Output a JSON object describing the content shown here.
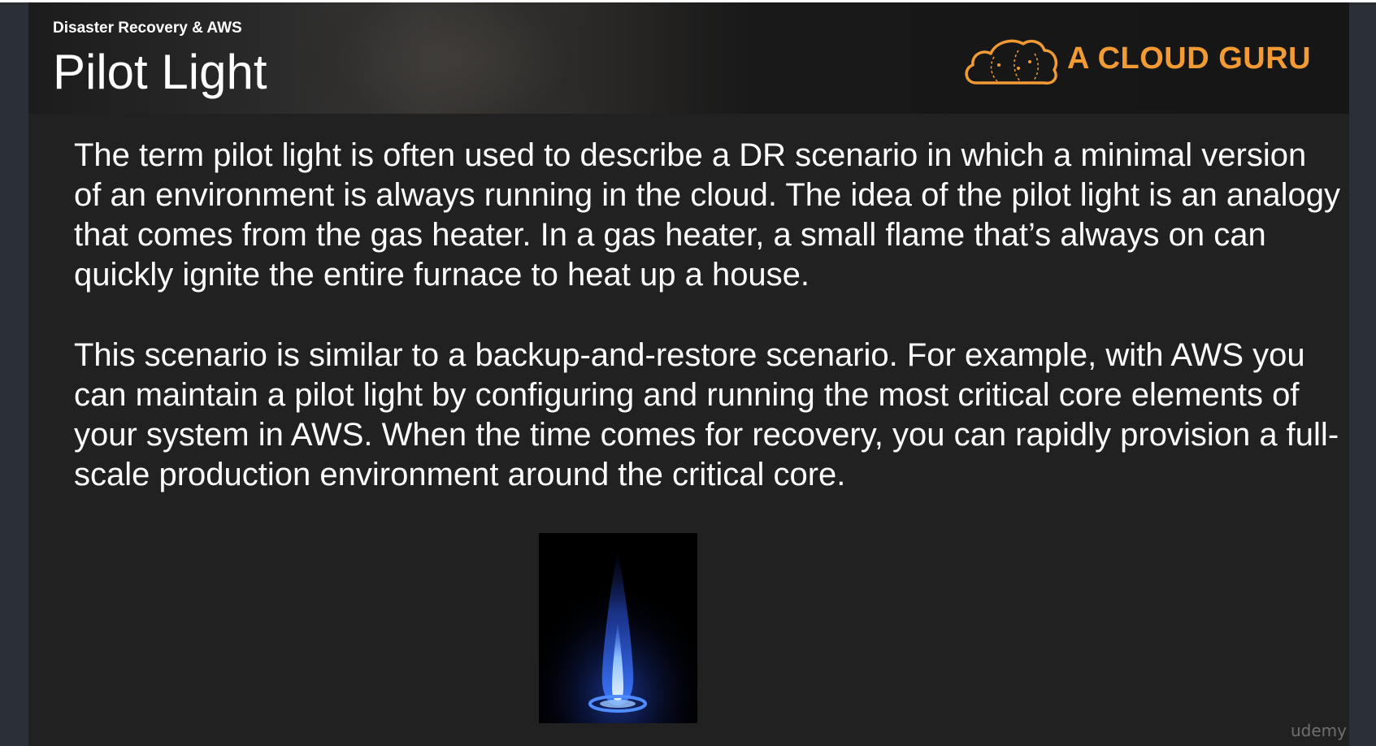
{
  "header": {
    "section_label": "Disaster Recovery & AWS",
    "title": "Pilot Light",
    "logo": {
      "icon": "cloud-logo-icon",
      "text": "A CLOUD GURU",
      "color": "#f29b35"
    }
  },
  "content": {
    "paragraph_1": "The term pilot light is often used to describe a DR scenario in which a minimal version of an environment is always running in the cloud. The idea of the pilot light is an analogy that comes from the gas heater. In a gas heater, a small flame that’s always on can quickly ignite the entire furnace to heat up a house.",
    "paragraph_2": "This scenario is similar to a backup-and-restore scenario. For example, with AWS you can maintain a pilot light by configuring and running the most critical core elements of your system in AWS. When the time comes for recovery, you can rapidly provision a full-scale production environment around the critical core.",
    "image": "gas-flame-image"
  },
  "watermark": "udemy",
  "colors": {
    "slide_background": "#212121",
    "outer_background": "#2b2f36",
    "text": "#ffffff",
    "flame": "#3d7bff"
  }
}
